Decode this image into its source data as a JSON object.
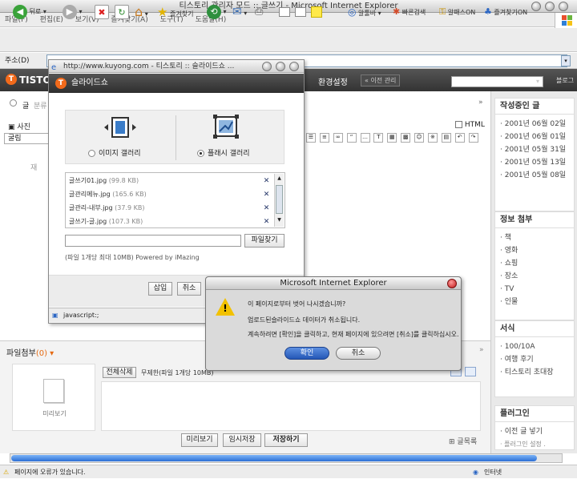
{
  "window_title": "티스토리 관리자 모드 :: 글쓰기 - Microsoft Internet Explorer",
  "menu": [
    "파일(F)",
    "편집(E)",
    "보기(V)",
    "즐겨찾기(A)",
    "도구(T)",
    "도움말(H)"
  ],
  "toolbar": {
    "back": "뒤로",
    "favorites": "즐겨찾기",
    "link1": "알툴바",
    "link2": "빠른검색",
    "link3": "알패스ON",
    "link4": "즐겨찾기ON"
  },
  "address": {
    "label": "주소(D)",
    "url": ""
  },
  "page": {
    "logo": "TISTO",
    "settings": "환경설정",
    "prev_manager": "« 이전 관리",
    "blog_link": "블로그",
    "category_label": "분류",
    "photo_label": "사진",
    "font_label": "굴림",
    "html_label": "HTML",
    "title_prefix": "재"
  },
  "right_panel": {
    "writing_title": "작성중인 글",
    "writing_items": [
      "· 2001년 06월 02일",
      "· 2001년 06월 01일",
      "· 2001년 05월 31일",
      "· 2001년 05월 13일",
      "· 2001년 05월 08일"
    ],
    "attach_title": "정보 첨부",
    "attach_items": [
      "· 책",
      "· 영화",
      "· 쇼핑",
      "· 장소",
      "· TV",
      "· 인물"
    ],
    "series_title": "서식",
    "series_items": [
      "· 100/10A",
      "· 여행 후기",
      "· 티스토리 초대장"
    ],
    "plugin_title": "플러그인",
    "plugin_items": [
      "· 이전 글 넣기",
      "· 플러그인 설정 ."
    ]
  },
  "bottom": {
    "attach_label": "파일첨부",
    "attach_count": "(0)",
    "delete_all": "전체삭제",
    "limit_text": "무제한(파일 1개당 10MB)",
    "preview_caption": "미리보기",
    "preview_btn": "미리보기",
    "temp_save_btn": "임시저장",
    "save_btn": "저장하기",
    "list_link": "글목록"
  },
  "popup": {
    "title": "http://www.kuyong.com - 티스토리 :: 슬라이드쇼 ...",
    "header": "슬라이드쇼",
    "option_image": "이미지 갤러리",
    "option_flash": "플래시 갤러리",
    "files": [
      {
        "name": "글쓰기01.jpg",
        "size": "(99.8 KB)"
      },
      {
        "name": "글관리메뉴.jpg",
        "size": "(165.6 KB)"
      },
      {
        "name": "글관리-내부.jpg",
        "size": "(37.9 KB)"
      },
      {
        "name": "글쓰기-글.jpg",
        "size": "(107.3 KB)"
      }
    ],
    "find_btn": "파일찾기",
    "note": "(파일 1개당 최대 10MB) Powered by iMazing",
    "insert_btn": "삽입",
    "cancel_btn": "취소",
    "status": "javascript:;"
  },
  "dialog": {
    "title": "Microsoft Internet Explorer",
    "line1": "이 페이지로부터 벗어 나시겠습니까?",
    "line2": "업로드된슬라이드쇼 데이터가 취소됩니다.",
    "line3": "계속하려면 [확인]을 클릭하고, 현재 페이지에 있으려면 [취소]를 클릭하십시오.",
    "ok": "확인",
    "cancel": "취소"
  },
  "status": {
    "left": "페이지에 오류가 있습니다.",
    "zone": "인터넷"
  }
}
